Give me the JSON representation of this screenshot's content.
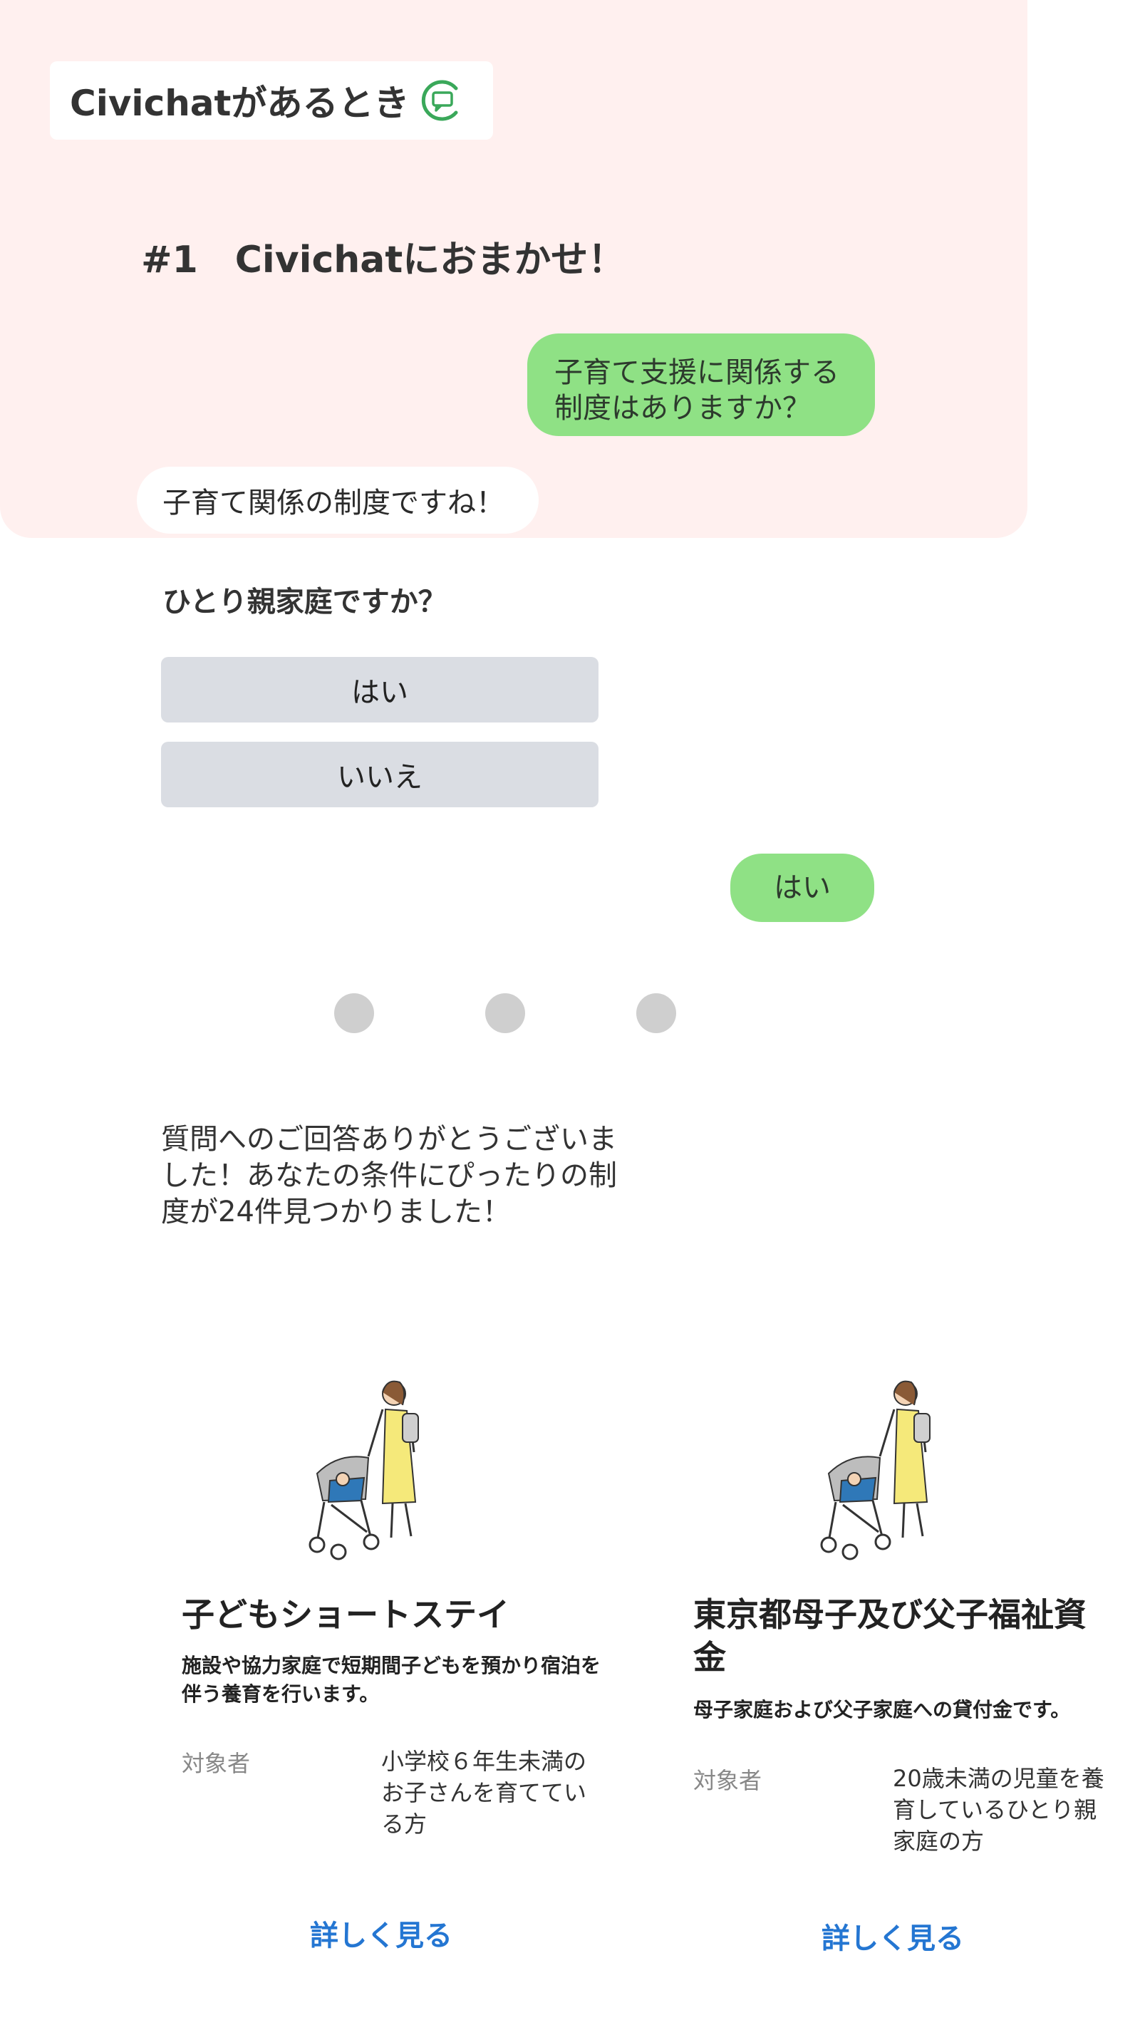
{
  "header": {
    "badge_text": "Civichatがあるとき"
  },
  "section": {
    "heading": "#1　Civichatにおまかせ！"
  },
  "chat": {
    "user_question": "子育て支援に関係する制度はありますか？",
    "bot_reply": "子育て関係の制度ですね！",
    "question": "ひとり親家庭ですか？",
    "options": [
      "はい",
      "いいえ"
    ],
    "user_answer": "はい",
    "result_message": "質問へのご回答ありがとうございました！あなたの条件にぴったりの制度が24件見つかりました！"
  },
  "cards": [
    {
      "title": "子どもショートステイ",
      "description": "施設や協力家庭で短期間子どもを預かり宿泊を伴う養育を行います。",
      "target_label": "対象者",
      "target_value": "小学校６年生未満のお子さんを育てている方",
      "link_label": "詳しく見る"
    },
    {
      "title": "東京都母子及び父子福祉資金",
      "description": "母子家庭および父子家庭への貸付金です。",
      "target_label": "対象者",
      "target_value": "20歳未満の児童を養育しているひとり親家庭の方",
      "link_label": "詳しく見る"
    }
  ],
  "colors": {
    "panel_background": "#fff0ef",
    "user_bubble": "#8fe185",
    "choice_button": "#dadde3",
    "link": "#2476d2",
    "logo_green": "#3aa85a"
  },
  "icons": {
    "badge_icon": "chat-bubble-icon",
    "card_illustration": "mother-with-stroller-illustration"
  }
}
